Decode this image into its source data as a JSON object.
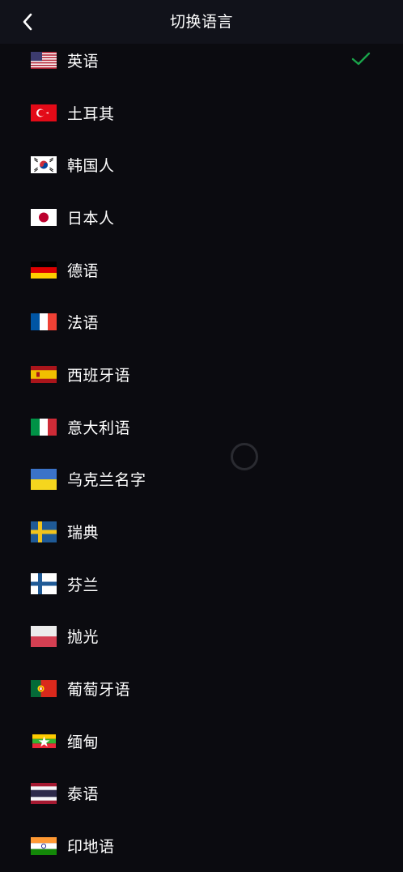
{
  "header": {
    "title": "切换语言",
    "back_icon": "chevron-left-icon"
  },
  "languages": [
    {
      "label": "英语",
      "flag": "us-flag-icon",
      "selected": true
    },
    {
      "label": "土耳其",
      "flag": "turkey-flag-icon",
      "selected": false
    },
    {
      "label": "韩国人",
      "flag": "south-korea-flag-icon",
      "selected": false
    },
    {
      "label": "日本人",
      "flag": "japan-flag-icon",
      "selected": false
    },
    {
      "label": "德语",
      "flag": "germany-flag-icon",
      "selected": false
    },
    {
      "label": "法语",
      "flag": "france-flag-icon",
      "selected": false
    },
    {
      "label": "西班牙语",
      "flag": "spain-flag-icon",
      "selected": false
    },
    {
      "label": "意大利语",
      "flag": "italy-flag-icon",
      "selected": false
    },
    {
      "label": "乌克兰名字",
      "flag": "ukraine-flag-icon",
      "selected": false
    },
    {
      "label": "瑞典",
      "flag": "sweden-flag-icon",
      "selected": false
    },
    {
      "label": "芬兰",
      "flag": "finland-flag-icon",
      "selected": false
    },
    {
      "label": "抛光",
      "flag": "poland-flag-icon",
      "selected": false
    },
    {
      "label": "葡萄牙语",
      "flag": "portugal-flag-icon",
      "selected": false
    },
    {
      "label": "缅甸",
      "flag": "myanmar-flag-icon",
      "selected": false
    },
    {
      "label": "泰语",
      "flag": "thailand-flag-icon",
      "selected": false
    },
    {
      "label": "印地语",
      "flag": "india-flag-icon",
      "selected": false
    }
  ],
  "colors": {
    "background": "#0b0b10",
    "header": "#11121a",
    "check": "#1aa34a"
  }
}
